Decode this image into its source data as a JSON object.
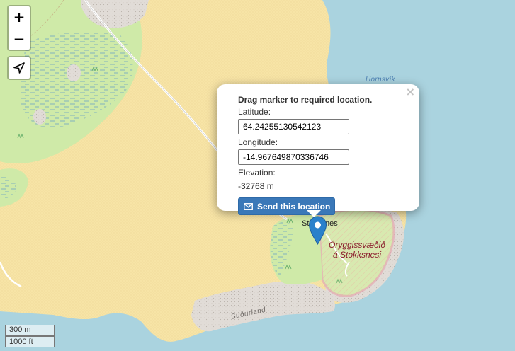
{
  "map": {
    "colors": {
      "water": "#aad3df",
      "sand": "#f7e4a6",
      "grass": "#cfeaa8",
      "meadow": "#add19e",
      "rock": "#e1dcd7",
      "reserve_border": "#e5a8b3",
      "path": "#f0c3a0"
    },
    "labels": {
      "bay": "Hornsvík",
      "place": "Stokksnes",
      "reserve_line1": "Öryggissvæðið",
      "reserve_line2": "á Stokksnesi",
      "region": "Suðurland"
    }
  },
  "controls": {
    "zoom_in": "+",
    "zoom_out": "−",
    "locate_icon": "locate-arrow-icon"
  },
  "popup": {
    "close": "×",
    "title": "Drag marker to required location.",
    "latitude_label": "Latitude:",
    "latitude_value": "64.24255130542123",
    "longitude_label": "Longitude:",
    "longitude_value": "-14.967649870336746",
    "elevation_label": "Elevation:",
    "elevation_value": "-32768 m",
    "send_button": "Send this location",
    "send_icon": "envelope-icon"
  },
  "marker": {
    "color": "#2a81cb",
    "icon": "map-pin-icon"
  },
  "scale": {
    "metric": "300 m",
    "imperial": "1000 ft"
  }
}
